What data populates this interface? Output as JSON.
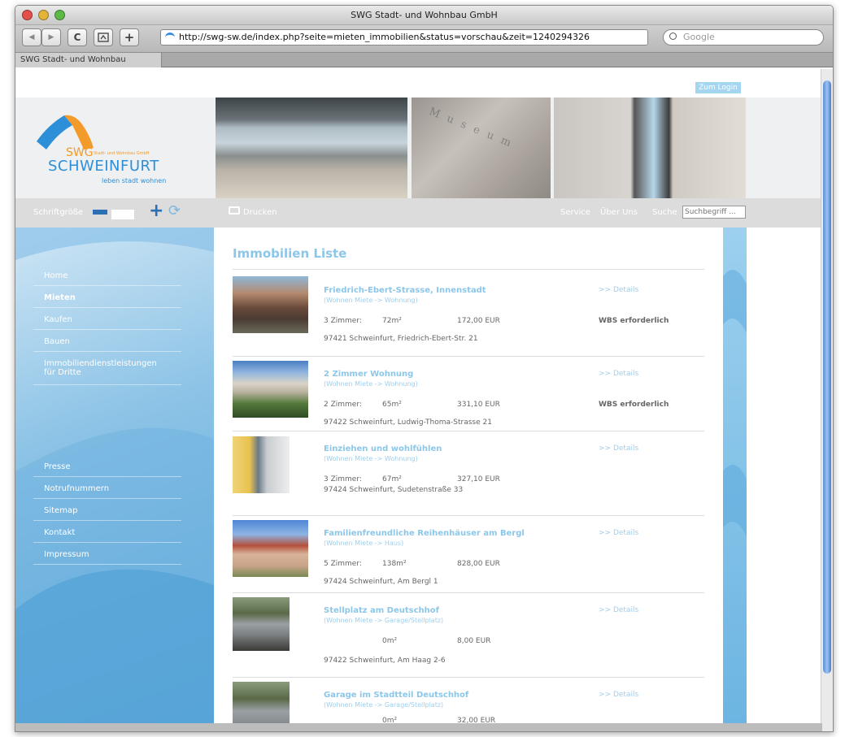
{
  "window": {
    "title": "SWG Stadt- und Wohnbau GmbH"
  },
  "toolbar": {
    "url": "http://swg-sw.de/index.php?seite=mieten_immobilien&status=vorschau&zeit=1240294326",
    "search_placeholder": "Google",
    "back": "◀",
    "forward": "▶",
    "reload": "C",
    "add": "+"
  },
  "tab": {
    "label": "SWG Stadt- und Wohnbau"
  },
  "site": {
    "login": "Zum Login",
    "logo_top": "SWG",
    "logo_small": "Stadt- und Wohnbau GmbH",
    "logo_main": "SCHWEINFURT",
    "logo_tagline": "leben stadt wohnen",
    "font_size_label": "Schriftgröße",
    "print_label": "Drucken",
    "service": "Service",
    "about": "Über Uns",
    "search_label": "Suche",
    "search_placeholder": "Suchbegriff ...",
    "accent": "#8cc7e9"
  },
  "nav": [
    {
      "label": "Home"
    },
    {
      "label": "Mieten"
    },
    {
      "label": "Kaufen"
    },
    {
      "label": "Bauen"
    },
    {
      "label": "Immobiliendienstleistungen für Dritte"
    },
    {
      "label": "Presse"
    },
    {
      "label": "Notrufnummern"
    },
    {
      "label": "Sitemap"
    },
    {
      "label": "Kontakt"
    },
    {
      "label": "Impressum"
    }
  ],
  "main": {
    "heading": "Immobilien Liste",
    "listings": [
      {
        "title": "Friedrich-Ebert-Strasse, Innenstadt",
        "category": "(Wohnen Miete -> Wohnung)",
        "rooms": "3 Zimmer:",
        "area": "72m²",
        "price": "172,00 EUR",
        "wbs": "WBS erforderlich",
        "details": ">> Details",
        "address": "97421 Schweinfurt, Friedrich-Ebert-Str. 21"
      },
      {
        "title": "2 Zimmer Wohnung",
        "category": "(Wohnen Miete -> Wohnung)",
        "rooms": "2 Zimmer:",
        "area": "65m²",
        "price": "331,10 EUR",
        "wbs": "WBS erforderlich",
        "details": ">> Details",
        "address": "97422 Schweinfurt, Ludwig-Thoma-Strasse 21"
      },
      {
        "title": "Einziehen und wohlfühlen",
        "category": "(Wohnen Miete -> Wohnung)",
        "rooms": "3 Zimmer:",
        "area": "67m²",
        "price": "327,10 EUR",
        "wbs": "",
        "details": ">> Details",
        "address": "97424 Schweinfurt, Sudetenstraße 33"
      },
      {
        "title": "Familienfreundliche Reihenhäuser am Bergl",
        "category": "(Wohnen Miete -> Haus)",
        "rooms": "5 Zimmer:",
        "area": "138m²",
        "price": "828,00 EUR",
        "wbs": "",
        "details": ">> Details",
        "address": "97424 Schweinfurt, Am Bergl 1"
      },
      {
        "title": "Stellplatz am Deutschhof",
        "category": "(Wohnen Miete -> Garage/Stellplatz)",
        "rooms": "",
        "area": "0m²",
        "price": "8,00 EUR",
        "wbs": "",
        "details": ">> Details",
        "address": "97422 Schweinfurt, Am Haag 2-6"
      },
      {
        "title": "Garage im Stadtteil Deutschhof",
        "category": "(Wohnen Miete -> Garage/Stellplatz)",
        "rooms": "",
        "area": "0m²",
        "price": "32,00 EUR",
        "wbs": "",
        "details": ">> Details",
        "address": ""
      }
    ]
  }
}
